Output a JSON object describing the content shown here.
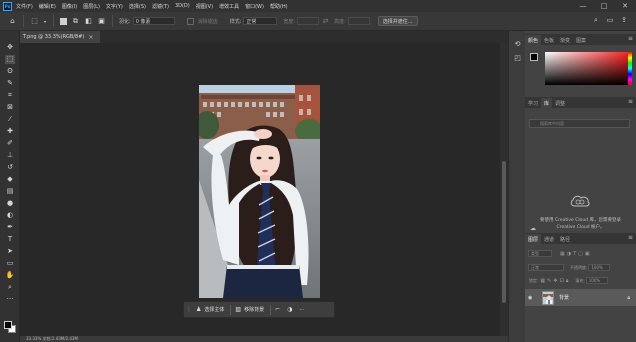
{
  "app": {
    "logo": "Ps"
  },
  "menu": [
    "文件(F)",
    "编辑(E)",
    "图像(I)",
    "图层(L)",
    "文字(Y)",
    "选择(S)",
    "滤镜(T)",
    "3D(D)",
    "视图(V)",
    "增效工具",
    "窗口(W)",
    "帮助(H)"
  ],
  "window_controls": {
    "minimize": "—",
    "maximize": "□",
    "close": "✕"
  },
  "options": {
    "feather_label": "羽化:",
    "feather_value": "0 像素",
    "antialias_label": "消除锯齿",
    "style_label": "样式:",
    "style_value": "正常",
    "width_label": "宽度:",
    "height_label": "高度:",
    "select_subject_button": "选择并遮住..."
  },
  "document": {
    "tab_title": "T.png @ 33.3%(RGB/8#)",
    "close": "×"
  },
  "context_bar": {
    "select_subject": "选择主体",
    "remove_background": "移除背景",
    "more": "···"
  },
  "status_bar": "33.33%    文档:2.43M/2.43M",
  "color_panel": {
    "tabs": [
      "颜色",
      "色板",
      "渐变",
      "图案"
    ],
    "fg_color": "#000000",
    "bg_color": "#ffffff"
  },
  "properties_panel": {
    "tabs": [
      "学习",
      "库",
      "调整"
    ],
    "search_placeholder": "搜索库中内容"
  },
  "cc_message": "要使用 Creative Cloud 库，您需要登录 Creative Cloud 帐户。",
  "layers_panel": {
    "tabs": [
      "图层",
      "通道",
      "路径"
    ],
    "filter_label": "类型",
    "blend_mode": "正常",
    "opacity_label": "不透明度:",
    "opacity_value": "100%",
    "lock_label": "锁定:",
    "fill_label": "填充:",
    "fill_value": "100%",
    "layer_name": "背景"
  }
}
